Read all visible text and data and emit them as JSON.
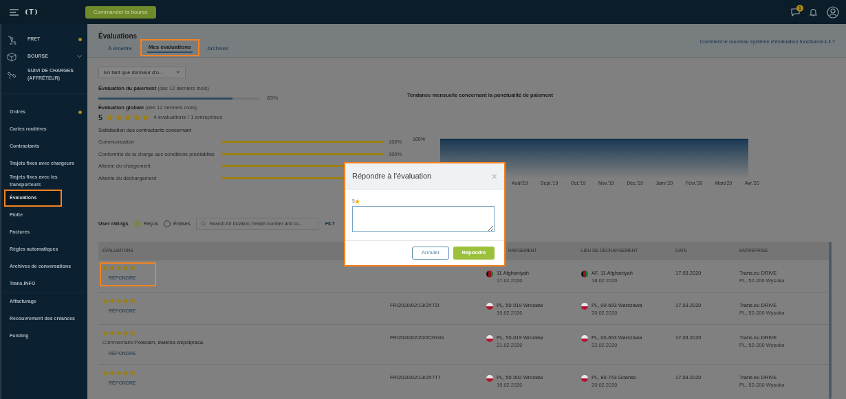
{
  "topbar": {
    "logo": "T",
    "order_button": "Commander la bourse",
    "notification_count": "1"
  },
  "sidebar": {
    "sections": [
      {
        "label": "FRET",
        "dot": true,
        "expandable": false
      },
      {
        "label": "BOURSE",
        "dot": false,
        "expandable": true
      },
      {
        "label": "SUIVI DE CHARGES (AFFRÉTEUR)",
        "dot": false,
        "expandable": false
      }
    ],
    "groups": [
      [
        {
          "label": "Ordres",
          "dot": true,
          "selected": false,
          "highlighted": false
        },
        {
          "label": "Cartes routières",
          "dot": false,
          "selected": false,
          "highlighted": false
        },
        {
          "label": "Contractants",
          "dot": false,
          "selected": false,
          "highlighted": false
        },
        {
          "label": "Trajets fixes avec chargeurs",
          "dot": false,
          "selected": false,
          "highlighted": false
        },
        {
          "label": "Trajets fixes avec les transporteurs",
          "dot": false,
          "selected": false,
          "highlighted": false
        },
        {
          "label": "Évaluations",
          "dot": false,
          "selected": true,
          "highlighted": true
        },
        {
          "label": "Flotte",
          "dot": false,
          "selected": false,
          "highlighted": false
        },
        {
          "label": "Factures",
          "dot": false,
          "selected": false,
          "highlighted": false
        },
        {
          "label": "Règles automatiques",
          "dot": false,
          "selected": false,
          "highlighted": false
        },
        {
          "label": "Archives de conversations",
          "dot": false,
          "selected": false,
          "highlighted": false
        },
        {
          "label": "Trans.INFO",
          "dot": false,
          "selected": false,
          "highlighted": false
        }
      ],
      [
        {
          "label": "Affacturage",
          "dot": false,
          "selected": false,
          "highlighted": false
        },
        {
          "label": "Recouvrement des créances",
          "dot": false,
          "selected": false,
          "highlighted": false
        },
        {
          "label": "Funding",
          "dot": false,
          "selected": false,
          "highlighted": false
        }
      ]
    ]
  },
  "page": {
    "title": "Évaluations",
    "tabs": [
      {
        "label": "À émettre",
        "selected": false,
        "highlighted": false
      },
      {
        "label": "Mes évaluations",
        "selected": true,
        "highlighted": true
      },
      {
        "label": "Archives",
        "selected": false,
        "highlighted": false
      }
    ],
    "help_link": "Comment le nouveau système d'évaluation fonctionne-t-il ?"
  },
  "role_dropdown": "En tant que donneur d'o...",
  "payment": {
    "label": "Évaluation du paiement",
    "period": "(des 12 derniers mois)",
    "level": 0.83,
    "reading": "83%"
  },
  "overall": {
    "label": "Évaluation globale",
    "period": "(des 12 derniers mois)",
    "score": "5",
    "stars": 5,
    "summary": "4 évaluations / 1 entreprises"
  },
  "satisfaction": {
    "title": "Satisfaction des contractants concernant",
    "criteria": [
      {
        "label": "Communication",
        "level": 1,
        "reading": "100%"
      },
      {
        "label": "Conformité de la charge aux conditions préétablies",
        "level": 1,
        "reading": "100%"
      },
      {
        "label": "Attente du chargement",
        "level": 1
      },
      {
        "label": "Attente du déchargement",
        "level": 1
      }
    ]
  },
  "trend": {
    "title": "Tendance mensuelle concernant la ponctualité de paiement",
    "y_label": "100%",
    "x_labels": [
      "Août'19",
      "Sept.'19",
      "Oct.'19",
      "Nov.'19",
      "Déc.'19",
      "Janv.'20",
      "Févr.'20",
      "Mars'20",
      "Avr.'20"
    ]
  },
  "ratings_filter": {
    "label": "User ratings",
    "options": [
      {
        "label": "Reçus",
        "selected": true
      },
      {
        "label": "Émises",
        "selected": false
      }
    ],
    "search_placeholder": "Search for location, freight number and co...",
    "filter_link": "FILT"
  },
  "table": {
    "columns": [
      "ÉVALUATIONS",
      "",
      "HARGEMENT",
      "LIEU DE DÉCHARGEMENT",
      "DATE",
      "ENTREPRISE"
    ],
    "rows": [
      {
        "stars": 5,
        "highlighted": true,
        "reply": "RÉPONDRE",
        "loading": {
          "kind": "af",
          "place": "11 Afghaniyah",
          "date": "17.02.2020"
        },
        "unloading": {
          "kind": "af",
          "place": "AF, 11 Afghaniyah",
          "date": "18.02.2020"
        },
        "date": "17.03.2020",
        "company": "Trans.eu DRIVE",
        "address": "PL, 52-200 Wysoka"
      },
      {
        "stars": 5,
        "highlighted": false,
        "reply": "RÉPONDRE",
        "number": "FR/2020/02/13/2X7ZI",
        "loading": {
          "kind": "pl",
          "place": "PL, 50-019 Wrocław",
          "date": "19.02.2020"
        },
        "unloading": {
          "kind": "pl",
          "place": "PL, 00-693 Warszawa",
          "date": "20.02.2020"
        },
        "date": "17.03.2020",
        "company": "Trans.eu DRIVE",
        "address": "PL, 52-200 Wysoka"
      },
      {
        "stars": 5,
        "highlighted": false,
        "comment_label": "Commentaire:",
        "comment": "Polecam, świetna współpraca.",
        "reply": "RÉPONDRE",
        "number": "FR/2020/02/20/2CRGG",
        "loading": {
          "kind": "pl",
          "place": "PL, 50-019 Wrocław",
          "date": "21.02.2020"
        },
        "unloading": {
          "kind": "pl",
          "place": "PL, 00-693 Warszawa",
          "date": "22.02.2020"
        },
        "date": "17.03.2020",
        "company": "Trans.eu DRIVE",
        "address": "PL, 52-200 Wysoka"
      },
      {
        "stars": 5,
        "highlighted": false,
        "reply": "RÉPONDRE",
        "number": "FR/2020/02/13/2X7TT",
        "loading": {
          "kind": "pl",
          "place": "PL, 50-002 Wrocław",
          "date": "19.02.2020"
        },
        "unloading": {
          "kind": "pl",
          "place": "PL, 80-743 Gdańsk",
          "date": "20.02.2020"
        },
        "date": "17.03.2020",
        "company": "Trans.eu DRIVE",
        "address": "PL, 52-200 Wysoka"
      }
    ]
  },
  "modal": {
    "title": "Répondre à l'évaluation",
    "close": "×",
    "highlighted": true,
    "rating": "5",
    "cancel": "Annuler",
    "submit": "Répondre"
  }
}
